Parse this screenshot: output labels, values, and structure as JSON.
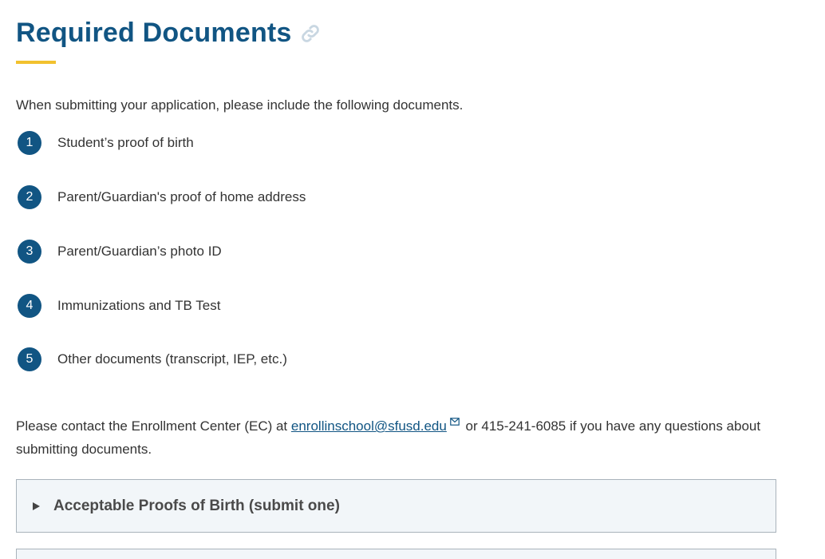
{
  "heading": {
    "title": "Required Documents"
  },
  "intro": "When submitting your application, please include the following documents.",
  "documents": [
    {
      "number": "1",
      "label": "Student’s proof of birth"
    },
    {
      "number": "2",
      "label": "Parent/Guardian's proof of home address"
    },
    {
      "number": "3",
      "label": "Parent/Guardian’s photo ID"
    },
    {
      "number": "4",
      "label": "Immunizations and TB Test"
    },
    {
      "number": "5",
      "label": "Other documents (transcript, IEP, etc.)"
    }
  ],
  "contact": {
    "prefix": "Please contact the Enrollment Center (EC) at ",
    "email": "enrollinschool@sfusd.edu",
    "suffix": " or 415-241-6085 if you have any questions about submitting documents."
  },
  "accordions": [
    {
      "title": "Acceptable Proofs of Birth (submit one)"
    }
  ],
  "colors": {
    "primary": "#115583",
    "accent": "#f2c12e",
    "text": "#333333"
  },
  "icons": {
    "title_link": "link-icon",
    "email": "mail-icon",
    "accordion": "triangle-right-icon"
  }
}
